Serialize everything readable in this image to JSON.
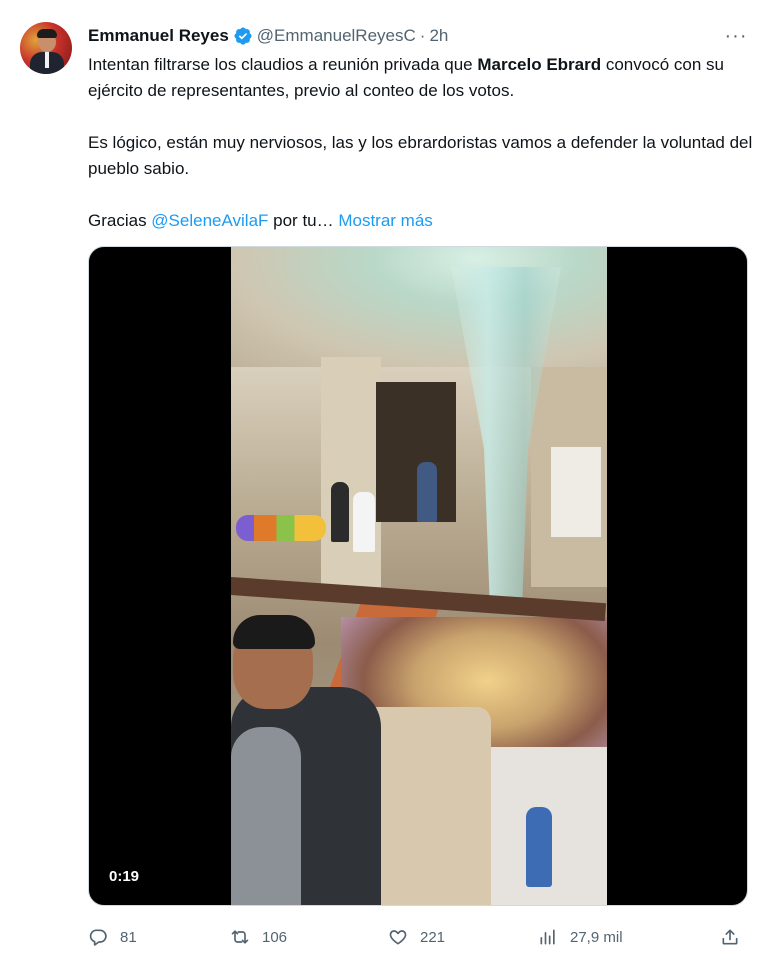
{
  "tweet": {
    "author": {
      "name": "Emmanuel Reyes",
      "handle": "@EmmanuelReyesC",
      "separator": "·",
      "time": "2h",
      "verified_color": "#1d9bf0"
    },
    "more_icon": "···",
    "text": {
      "p1_before": "Intentan filtrarse los claudios a reunión privada que ",
      "p1_bold": "Marcelo Ebrard",
      "p1_after": " convocó con su ejército de representantes, previo al conteo de los votos.",
      "p2": "Es lógico, están muy nerviosos, las y los ebrardoristas vamos a defender la voluntad del pueblo sabio.",
      "p3_before": "Gracias ",
      "p3_mention": "@SeleneAvilaF",
      "p3_after": " por tu… ",
      "show_more": "Mostrar más"
    },
    "media": {
      "duration": "0:19"
    },
    "actions": {
      "replies": "81",
      "retweets": "106",
      "likes": "221",
      "views": "27,9 mil"
    }
  },
  "colors": {
    "text": "#0f1419",
    "secondary": "#536471",
    "link": "#1d9bf0"
  }
}
